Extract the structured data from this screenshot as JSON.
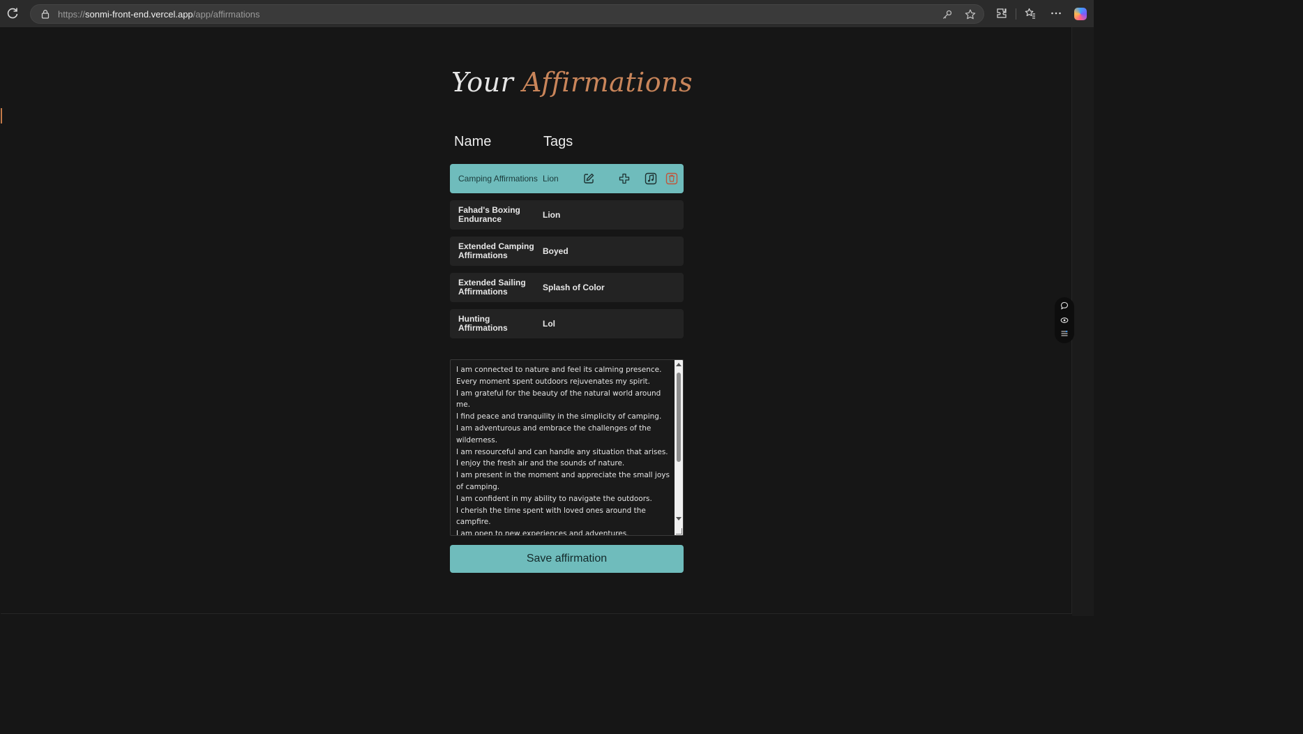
{
  "browser": {
    "url_scheme": "https://",
    "url_host": "sonmi-front-end.vercel.app",
    "url_path": "/app/affirmations"
  },
  "page": {
    "title_part1": "Your",
    "title_part2": "Affirmations",
    "columns": {
      "name": "Name",
      "tags": "Tags"
    },
    "rows": [
      {
        "name": "Camping Affirmations",
        "tag": "Lion",
        "active": true
      },
      {
        "name": "Fahad's Boxing Endurance",
        "tag": "Lion"
      },
      {
        "name": "Extended Camping Affirmations",
        "tag": "Boyed"
      },
      {
        "name": "Extended Sailing Affirmations",
        "tag": "Splash of Color"
      },
      {
        "name": "Hunting Affirmations",
        "tag": "Lol"
      }
    ],
    "row_actions": [
      "edit-icon",
      "add-icon",
      "music-icon",
      "delete-icon"
    ],
    "affirmation_text": "I am connected to nature and feel its calming presence.\nEvery moment spent outdoors rejuvenates my spirit.\nI am grateful for the beauty of the natural world around me.\nI find peace and tranquility in the simplicity of camping.\nI am adventurous and embrace the challenges of the wilderness.\nI am resourceful and can handle any situation that arises.\nI enjoy the fresh air and the sounds of nature.\nI am present in the moment and appreciate the small joys of camping.\nI am confident in my ability to navigate the outdoors.\nI cherish the time spent with loved ones around the campfire.\nI am open to new experiences and adventures.\nI respect and protect the environment I camp in.\nI am at ease in the natural world and feel at home.",
    "save_label": "Save affirmation"
  },
  "colors": {
    "accent": "#6fbcbc",
    "title_accent": "#c9855a",
    "delete": "#c0553a",
    "background": "#161616"
  }
}
